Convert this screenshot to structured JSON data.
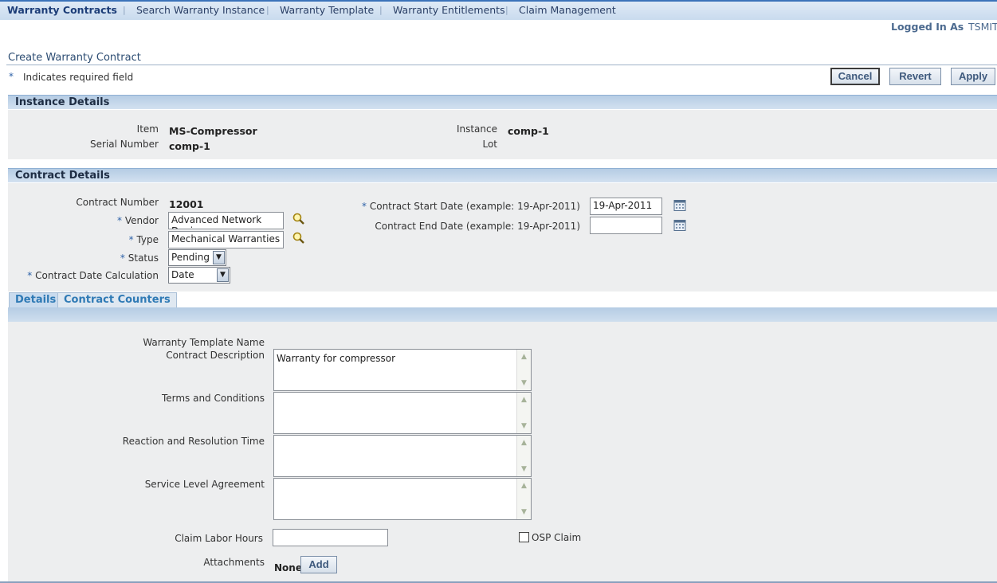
{
  "nav": {
    "items": [
      "Warranty Contracts",
      "Search Warranty Instance",
      "Warranty Template",
      "Warranty Entitlements",
      "Claim Management"
    ],
    "active": "Warranty Contracts"
  },
  "user": {
    "logged_in_label": "Logged In As",
    "username": "TSMIT"
  },
  "page": {
    "title": "Create Warranty Contract",
    "required_note": "Indicates required field",
    "required_marker": "*"
  },
  "buttons": {
    "cancel": "Cancel",
    "revert": "Revert",
    "apply": "Apply",
    "add": "Add"
  },
  "instance_details": {
    "header": "Instance Details",
    "item_label": "Item",
    "item_value": "MS-Compressor",
    "serial_label": "Serial Number",
    "serial_value": "comp-1",
    "instance_label": "Instance",
    "instance_value": "comp-1",
    "lot_label": "Lot",
    "lot_value": ""
  },
  "contract_details": {
    "header": "Contract Details",
    "contract_number_label": "Contract Number",
    "contract_number_value": "12001",
    "vendor_label": "Vendor",
    "vendor_value": "Advanced Network Devic",
    "type_label": "Type",
    "type_value": "Mechanical Warranties",
    "status_label": "Status",
    "status_value": "Pending",
    "date_calc_label": "Contract Date Calculation",
    "date_calc_value": "Date",
    "start_date_label": "Contract Start Date (example: 19-Apr-2011)",
    "start_date_value": "19-Apr-2011",
    "end_date_label": "Contract End Date (example: 19-Apr-2011)",
    "end_date_value": ""
  },
  "tabs": [
    "Details",
    "Contract Counters"
  ],
  "details": {
    "template_name_label": "Warranty Template Name",
    "description_label": "Contract Description",
    "description_value": "Warranty for compressor",
    "terms_label": "Terms and Conditions",
    "terms_value": "",
    "reaction_label": "Reaction and Resolution Time",
    "reaction_value": "",
    "sla_label": "Service Level Agreement",
    "sla_value": "",
    "labor_hours_label": "Claim Labor Hours",
    "labor_hours_value": "",
    "osp_claim_label": "OSP Claim",
    "attachments_label": "Attachments",
    "attachments_value": "None"
  },
  "colors": {
    "accent": "#3b73b9",
    "section_bar": "#c2d6ea",
    "panel": "#edeeef",
    "tab_text": "#2f7ab5"
  }
}
